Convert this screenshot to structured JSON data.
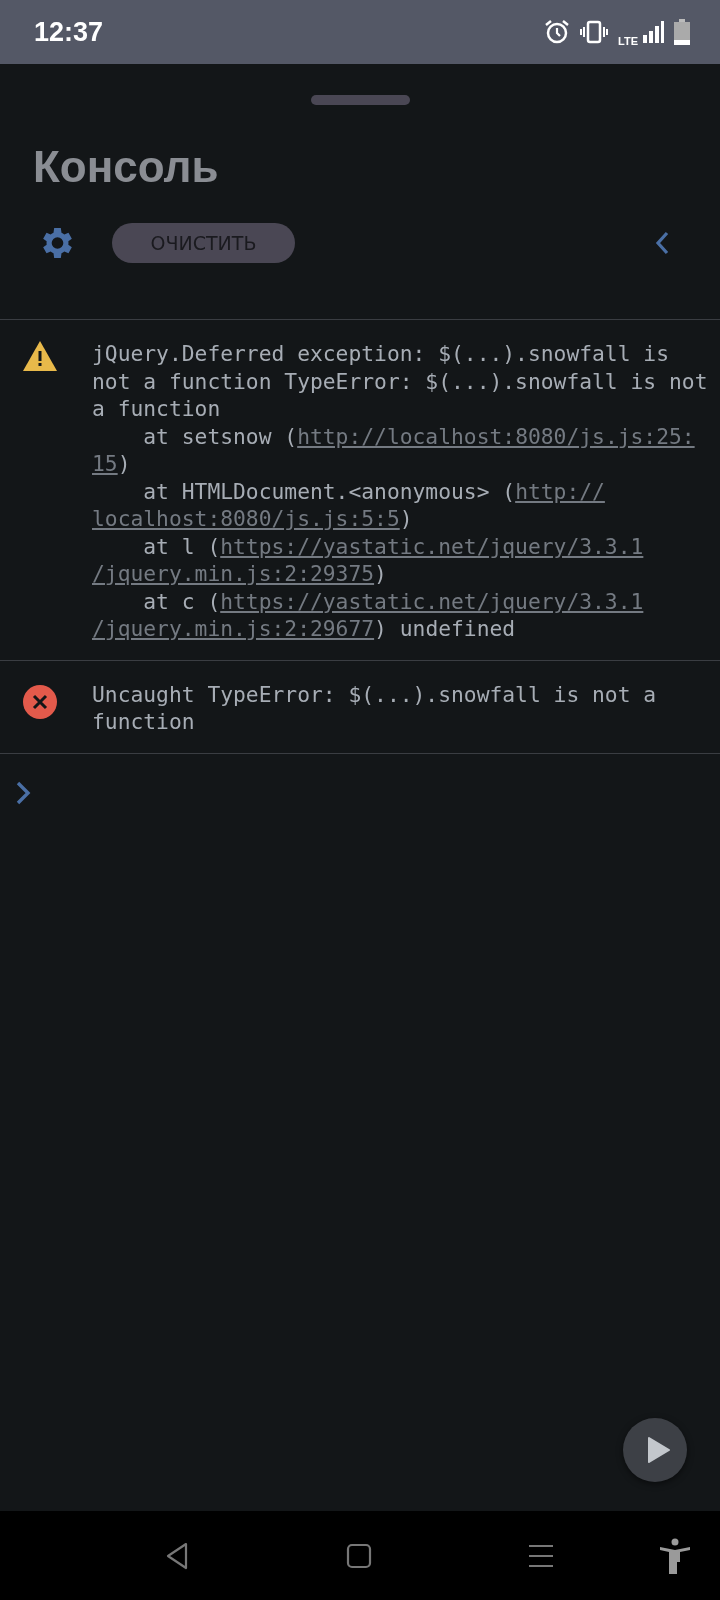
{
  "status_bar": {
    "time": "12:37",
    "network": "LTE"
  },
  "panel": {
    "title": "Консоль",
    "clear_button": "ОЧИСТИТЬ"
  },
  "messages": [
    {
      "kind": "warning",
      "lines": [
        [
          {
            "text": "jQuery.Deferred exception: $(...).snowfall is"
          }
        ],
        [
          {
            "text": "not a function TypeError: $(...).snowfall is not"
          }
        ],
        [
          {
            "text": "a function"
          }
        ],
        [
          {
            "text": "    at setsnow ("
          },
          {
            "text": "http://localhost:8080/js.js:25:",
            "link": true
          }
        ],
        [
          {
            "text": "15",
            "link": true
          },
          {
            "text": ")"
          }
        ],
        [
          {
            "text": "    at HTMLDocument.<anonymous> ("
          },
          {
            "text": "http://",
            "link": true
          }
        ],
        [
          {
            "text": "localhost:8080/js.js:5:5",
            "link": true
          },
          {
            "text": ")"
          }
        ],
        [
          {
            "text": "    at l ("
          },
          {
            "text": "https://yastatic.net/jquery/3.3.1",
            "link": true
          }
        ],
        [
          {
            "text": "/jquery.min.js:2:29375",
            "link": true
          },
          {
            "text": ")"
          }
        ],
        [
          {
            "text": "    at c ("
          },
          {
            "text": "https://yastatic.net/jquery/3.3.1",
            "link": true
          }
        ],
        [
          {
            "text": "/jquery.min.js:2:29677",
            "link": true
          },
          {
            "text": ") undefined"
          }
        ]
      ]
    },
    {
      "kind": "error",
      "lines": [
        [
          {
            "text": "Uncaught TypeError: $(...).snowfall is not a"
          }
        ],
        [
          {
            "text": "function"
          }
        ]
      ]
    }
  ]
}
